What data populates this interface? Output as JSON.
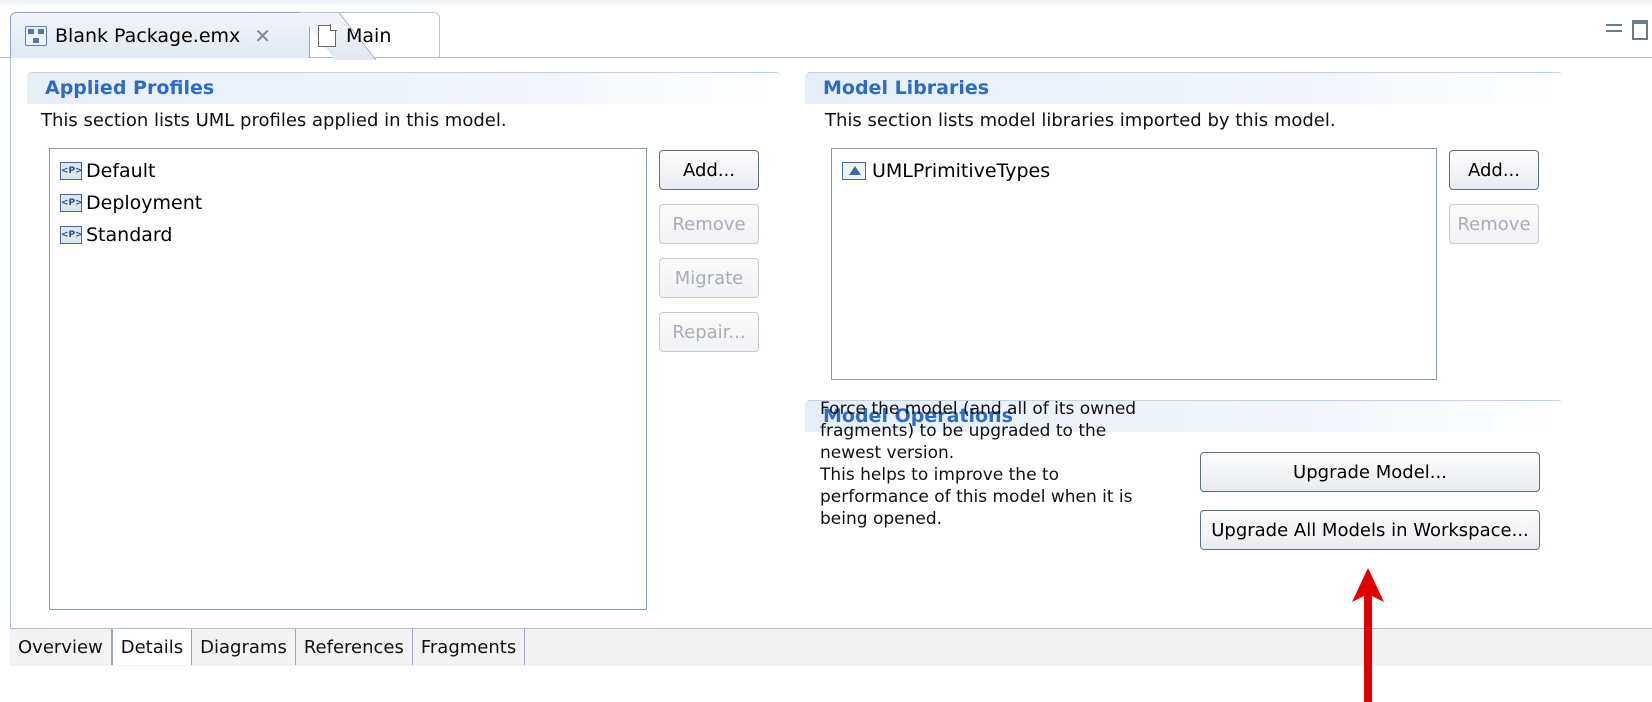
{
  "editor_tabs": [
    {
      "label": "Blank Package.emx",
      "close": "✕"
    },
    {
      "label": "Main"
    }
  ],
  "applied_profiles": {
    "title": "Applied Profiles",
    "description": "This section lists UML profiles applied in this model.",
    "items": [
      "Default",
      "Deployment",
      "Standard"
    ],
    "buttons": {
      "add": "Add...",
      "remove": "Remove",
      "migrate": "Migrate",
      "repair": "Repair..."
    }
  },
  "model_libraries": {
    "title": "Model Libraries",
    "description": "This section lists model libraries imported by this model.",
    "items": [
      "UMLPrimitiveTypes"
    ],
    "buttons": {
      "add": "Add...",
      "remove": "Remove"
    }
  },
  "model_operations": {
    "title": "Model Operations",
    "description": "Force the model (and all of its owned\nfragments) to be upgraded to the\nnewest version.\nThis helps to improve the to\nperformance of this model when it is\nbeing opened.",
    "upgrade_model": "Upgrade Model...",
    "upgrade_all": "Upgrade All Models in Workspace..."
  },
  "bottom_tabs": [
    "Overview",
    "Details",
    "Diagrams",
    "References",
    "Fragments"
  ],
  "active_bottom_tab": "Details",
  "colors": {
    "section_title": "#2f6bc2",
    "annotation_arrow": "#e00000"
  }
}
